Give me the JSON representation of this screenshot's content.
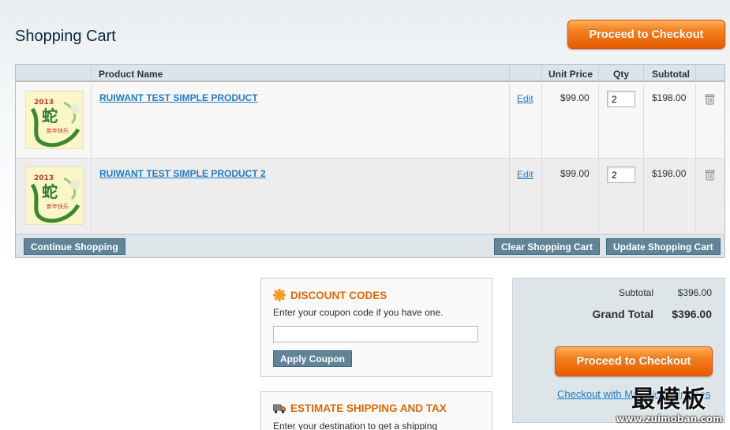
{
  "page": {
    "title": "Shopping Cart"
  },
  "checkout": {
    "top_label": "Proceed to Checkout",
    "bottom_label": "Proceed to Checkout",
    "multi_label": "Checkout with Multiple Addresses"
  },
  "table": {
    "headers": {
      "name": "Product Name",
      "unit": "Unit Price",
      "qty": "Qty",
      "subtotal": "Subtotal"
    },
    "rows": [
      {
        "name": "RUIWANT TEST SIMPLE PRODUCT",
        "edit": "Edit",
        "unit": "$99.00",
        "qty": "2",
        "subtotal": "$198.00"
      },
      {
        "name": "RUIWANT TEST SIMPLE PRODUCT 2",
        "edit": "Edit",
        "unit": "$99.00",
        "qty": "2",
        "subtotal": "$198.00"
      }
    ],
    "actions": {
      "continue": "Continue Shopping",
      "clear": "Clear Shopping Cart",
      "update": "Update Shopping Cart"
    }
  },
  "discount": {
    "title": "DISCOUNT CODES",
    "text": "Enter your coupon code if you have one.",
    "coupon_value": "",
    "button": "Apply Coupon"
  },
  "shipping": {
    "title": "ESTIMATE SHIPPING AND TAX",
    "text": "Enter your destination to get a shipping"
  },
  "totals": {
    "subtotal_label": "Subtotal",
    "subtotal_value": "$396.00",
    "grand_label": "Grand Total",
    "grand_value": "$396.00"
  },
  "thumbnail": {
    "year": "2013",
    "main_char": "蛇",
    "greeting": "新年快乐"
  },
  "watermark": {
    "cn": "最模板",
    "en": "www.zuimoban.com"
  },
  "colors": {
    "accent_orange": "#f5811f",
    "link_blue": "#1e7ec8",
    "title_navy": "#0a263c",
    "button_gray": "#618499",
    "header_blue": "#d9e5ee"
  }
}
